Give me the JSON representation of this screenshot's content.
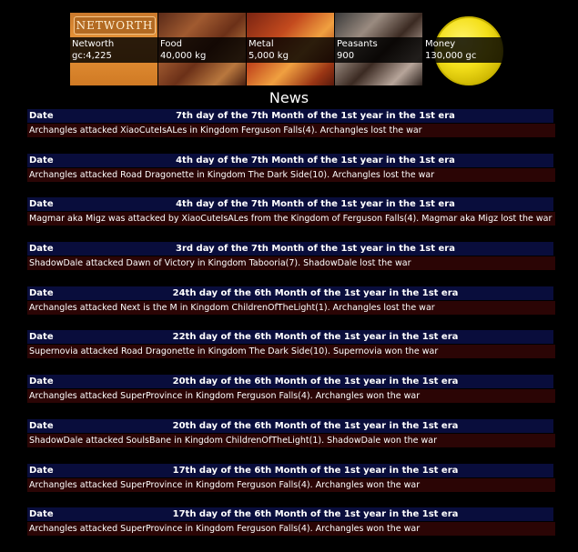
{
  "stats": {
    "networth": {
      "logo": "NETWORTH",
      "label": "Networth",
      "value": "gc:4,225"
    },
    "food": {
      "label": "Food",
      "value": "40,000 kg"
    },
    "metal": {
      "label": "Metal",
      "value": "5,000 kg"
    },
    "peasants": {
      "label": "Peasants",
      "value": "900"
    },
    "money": {
      "label": "Money",
      "value": "130,000 gc"
    }
  },
  "news": {
    "title": "News",
    "date_label": "Date",
    "items": [
      {
        "date": "7th day of the 7th Month of the 1st year in the 1st era",
        "text": "Archangles attacked XiaoCuteIsALes in Kingdom Ferguson Falls(4). Archangles lost the war"
      },
      {
        "date": "4th day of the 7th Month of the 1st year in the 1st era",
        "text": "Archangles attacked Road Dragonette in Kingdom The Dark Side(10). Archangles lost the war"
      },
      {
        "date": "4th day of the 7th Month of the 1st year in the 1st era",
        "text": "Magmar aka Migz was attacked by XiaoCuteIsALes from the Kingdom of Ferguson Falls(4). Magmar aka Migz lost the war"
      },
      {
        "date": "3rd day of the 7th Month of the 1st year in the 1st era",
        "text": "ShadowDale attacked Dawn of Victory in Kingdom Tabooria(7). ShadowDale lost the war"
      },
      {
        "date": "24th day of the 6th Month of the 1st year in the 1st era",
        "text": "Archangles attacked Next is the M in Kingdom ChildrenOfTheLight(1). Archangles lost the war"
      },
      {
        "date": "22th day of the 6th Month of the 1st year in the 1st era",
        "text": "Supernovia attacked Road Dragonette in Kingdom The Dark Side(10). Supernovia won the war"
      },
      {
        "date": "20th day of the 6th Month of the 1st year in the 1st era",
        "text": "Archangles attacked SuperProvince in Kingdom Ferguson Falls(4). Archangles won the war"
      },
      {
        "date": "20th day of the 6th Month of the 1st year in the 1st era",
        "text": "ShadowDale attacked SoulsBane in Kingdom ChildrenOfTheLight(1). ShadowDale won the war"
      },
      {
        "date": "17th day of the 6th Month of the 1st year in the 1st era",
        "text": "Archangles attacked SuperProvince in Kingdom Ferguson Falls(4). Archangles won the war"
      },
      {
        "date": "17th day of the 6th Month of the 1st year in the 1st era",
        "text": "Archangles attacked SuperProvince in Kingdom Ferguson Falls(4). Archangles won the war"
      }
    ]
  },
  "colors": {
    "background": "#000000",
    "date_bar": "#090d3c",
    "message_bar": "#2b0505",
    "coin": "#f4e01a"
  }
}
